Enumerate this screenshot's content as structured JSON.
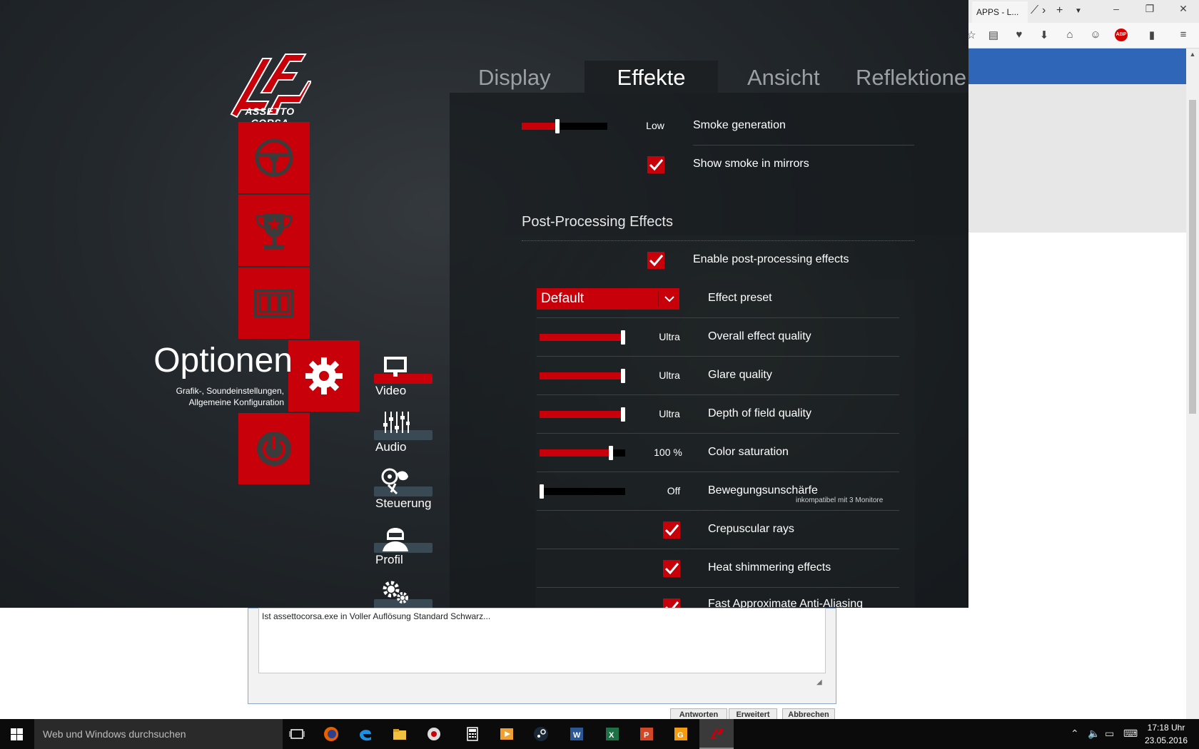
{
  "browser": {
    "tab_label": "APPS - L...",
    "nav_icons": [
      "reader-icon",
      "pocket-icon",
      "download-icon",
      "home-icon",
      "emoji-icon",
      "adblock-icon",
      "bookmark-icon",
      "menu-icon"
    ],
    "abp_label": "ABP",
    "forum": {
      "textarea_text": "Ist assettocorsa.exe in Voller Auflösung Standard Schwarz...",
      "buttons": [
        "Antworten",
        "Erweitert",
        "Abbrechen"
      ]
    }
  },
  "game": {
    "logo_text": "ASSETTO CORSA",
    "section": {
      "title": "Optionen",
      "description_line1": "Grafik-, Soundeinstellungen,",
      "description_line2": "Allgemeine Konfiguration"
    },
    "main_menu": [
      "steering-wheel-icon",
      "trophy-icon",
      "film-strip-icon",
      "gear-icon",
      "power-icon"
    ],
    "submenu": [
      {
        "label": "Video",
        "icon": "monitor-icon"
      },
      {
        "label": "Audio",
        "icon": "mixer-icon"
      },
      {
        "label": "Steuerung",
        "icon": "controls-icon"
      },
      {
        "label": "Profil",
        "icon": "driver-helmet-icon"
      },
      {
        "label": "",
        "icon": "general-gears-icon"
      }
    ],
    "tabs": [
      "Display",
      "Effekte",
      "Ansicht",
      "Reflektione"
    ],
    "active_tab": "Effekte",
    "settings": {
      "smoke_generation": {
        "label": "Smoke generation",
        "value": "Low",
        "level": 0.42
      },
      "show_smoke_mirrors": {
        "label": "Show smoke in mirrors",
        "checked": true
      },
      "post_header": "Post-Processing Effects",
      "enable_post": {
        "label": "Enable post-processing effects",
        "checked": true
      },
      "effect_preset": {
        "label": "Effect preset",
        "value": "Default"
      },
      "overall_quality": {
        "label": "Overall effect quality",
        "value": "Ultra",
        "level": 1.0
      },
      "glare_quality": {
        "label": "Glare quality",
        "value": "Ultra",
        "level": 1.0
      },
      "dof_quality": {
        "label": "Depth of field quality",
        "value": "Ultra",
        "level": 1.0
      },
      "color_saturation": {
        "label": "Color saturation",
        "value": "100 %",
        "level": 0.83
      },
      "motion_blur": {
        "label": "Bewegungsunschärfe",
        "value": "Off",
        "level": 0.0,
        "note": "inkompatibel mit 3 Monitore"
      },
      "crepuscular_rays": {
        "label": "Crepuscular rays",
        "checked": true
      },
      "heat_shimmering": {
        "label": "Heat shimmering effects",
        "checked": true
      },
      "fxaa": {
        "label": "Fast Approximate Anti-Aliasing",
        "checked": true
      }
    }
  },
  "taskbar": {
    "search_placeholder": "Web und Windows durchsuchen",
    "apps": [
      "task-view-icon",
      "firefox-icon",
      "edge-icon",
      "explorer-icon",
      "app-icon",
      "calculator-icon",
      "media-icon",
      "steam-icon",
      "word-icon",
      "excel-icon",
      "powerpoint-icon",
      "g-app-icon",
      "assetto-corsa-icon"
    ],
    "time": "17:18 Uhr",
    "date": "23.05.2016"
  },
  "colors": {
    "accent_red": "#c8000a",
    "game_bg": "#23282c",
    "browser_blue": "#2f66b7"
  }
}
